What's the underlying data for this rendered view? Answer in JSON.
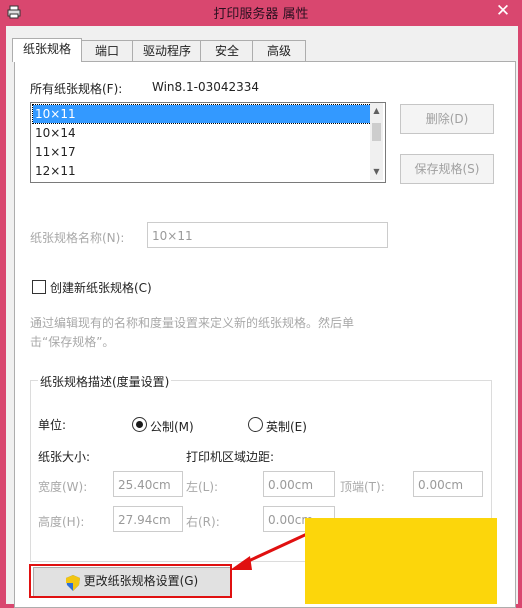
{
  "window": {
    "title": "打印服务器 属性",
    "close_glyph": "✕"
  },
  "tabs": [
    {
      "label": "纸张规格",
      "active": true
    },
    {
      "label": "端口"
    },
    {
      "label": "驱动程序"
    },
    {
      "label": "安全"
    },
    {
      "label": "高级"
    }
  ],
  "forms": {
    "all_label": "所有纸张规格(F):",
    "server_name": "Win8.1-03042334",
    "list_items": [
      "10×11",
      "10×14",
      "11×17",
      "12×11"
    ],
    "selected": "10×11",
    "delete_button": "删除(D)",
    "save_button": "保存规格(S)",
    "name_label": "纸张规格名称(N):",
    "name_value": "10×11",
    "create_new": "创建新纸张规格(C)",
    "hint_line1": "通过编辑现有的名称和度量设置来定义新的纸张规格。然后单",
    "hint_line2": "击“保存规格”。"
  },
  "description": {
    "title": "纸张规格描述(度量设置)",
    "unit_label": "单位:",
    "unit_metric": "公制(M)",
    "unit_english": "英制(E)",
    "selected_unit": "公制(M)",
    "paper_size_label": "纸张大小:",
    "margins_label": "打印机区域边距:",
    "width_label": "宽度(W):",
    "width_value": "25.40cm",
    "height_label": "高度(H):",
    "height_value": "27.94cm",
    "left_label": "左(L):",
    "left_value": "0.00cm",
    "right_label": "右(R):",
    "right_value": "0.00cm",
    "top_label": "顶端(T):",
    "top_value": "0.00cm"
  },
  "change_button": "更改纸张规格设置(G)",
  "colors": {
    "title_bar": "#d9476f",
    "selection": "#3399ff",
    "highlight_frame": "#e01010",
    "arrow": "#e01010",
    "watermark_panel": "#fcd60b"
  }
}
